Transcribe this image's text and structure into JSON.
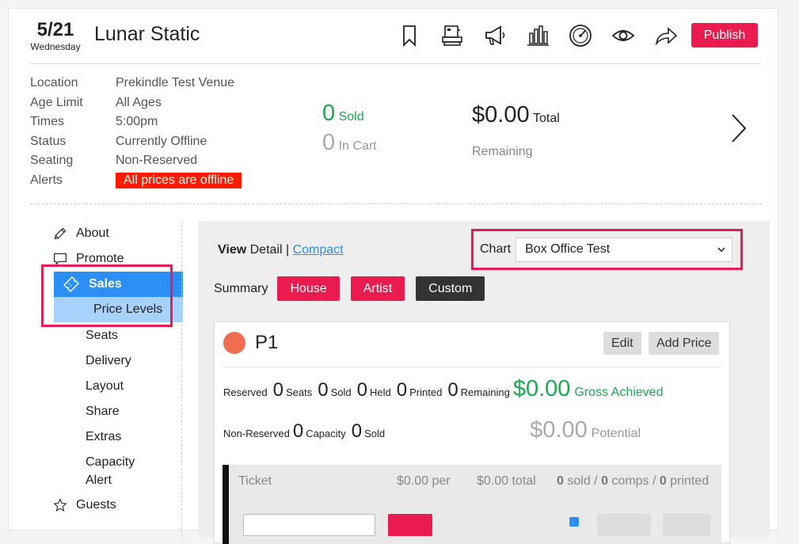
{
  "header": {
    "date": "5/21",
    "weekday": "Wednesday",
    "event_title": "Lunar Static",
    "publish_label": "Publish",
    "toolbar_icons": [
      "bookmark-icon",
      "register-icon",
      "megaphone-icon",
      "bar-chart-icon",
      "gauge-icon",
      "eye-icon",
      "share-icon"
    ]
  },
  "info": {
    "rows": [
      {
        "label": "Location",
        "value": "Prekindle Test Venue"
      },
      {
        "label": "Age Limit",
        "value": "All Ages"
      },
      {
        "label": "Times",
        "value": "5:00pm"
      },
      {
        "label": "Status",
        "value": "Currently Offline"
      },
      {
        "label": "Seating",
        "value": "Non-Reserved"
      },
      {
        "label": "Alerts",
        "value": "All prices are offline"
      }
    ]
  },
  "stats": {
    "sold_count": "0",
    "sold_label": "Sold",
    "cart_count": "0",
    "cart_label": "In Cart",
    "total_amount": "$0.00",
    "total_label": "Total",
    "remaining_label": "Remaining"
  },
  "sidebar": {
    "items": [
      {
        "label": "About",
        "icon": "pencil-icon"
      },
      {
        "label": "Promote",
        "icon": "speech-bubble-icon"
      },
      {
        "label": "Sales",
        "icon": "ticket-icon"
      }
    ],
    "sub_items": [
      "Price Levels",
      "Seats",
      "Delivery",
      "Layout",
      "Share",
      "Extras"
    ],
    "capacity_line1": "Capacity",
    "capacity_line2": "Alert",
    "guests_label": "Guests"
  },
  "main": {
    "view_label": "View",
    "detail_label": "Detail",
    "separator": "|",
    "compact_label": "Compact",
    "chart_label": "Chart",
    "chart_value": "Box Office Test",
    "summary_label": "Summary",
    "summary_buttons": [
      "House",
      "Artist",
      "Custom"
    ]
  },
  "price_level": {
    "name": "P1",
    "edit_label": "Edit",
    "add_price_label": "Add Price",
    "reserved_label": "Reserved",
    "reserved_seats": "0",
    "seats_label": "Seats",
    "reserved_sold": "0",
    "sold_label": "Sold",
    "reserved_held": "0",
    "held_label": "Held",
    "reserved_printed": "0",
    "printed_label": "Printed",
    "reserved_remaining": "0",
    "remaining_label": "Remaining",
    "gross_amount": "$0.00",
    "gross_label": "Gross Achieved",
    "nonreserved_label": "Non-Reserved",
    "nr_capacity": "0",
    "capacity_label": "Capacity",
    "nr_sold": "0",
    "nr_sold_label": "Sold",
    "potential_amount": "$0.00",
    "potential_label": "Potential"
  },
  "ticket": {
    "name": "Ticket",
    "per": "$0.00 per",
    "total": "$0.00 total",
    "sold_count": "0",
    "sold_text": "sold /",
    "comps_count": "0",
    "comps_text": "comps /",
    "printed_count": "0",
    "printed_text": "printed"
  },
  "colors": {
    "brand_red": "#ea1c4f",
    "active_blue": "#2b8ff5",
    "light_blue": "#a8d1fb",
    "green": "#1aab4f",
    "alert_red": "#ff1a00"
  }
}
